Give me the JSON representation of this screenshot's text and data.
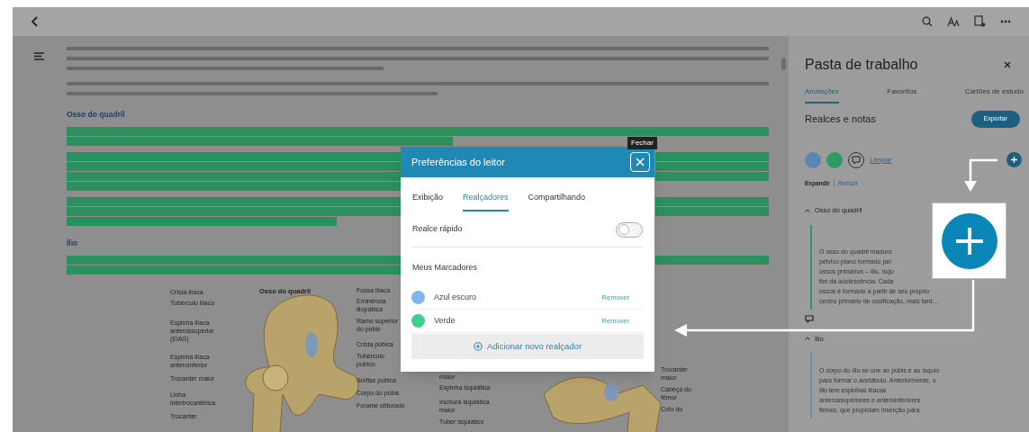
{
  "document": {
    "blocks": [
      {
        "kind": "paragraph",
        "highlighted": false
      },
      {
        "kind": "paragraph",
        "highlighted": false
      },
      {
        "kind": "heading",
        "text": "Osso do quadril"
      },
      {
        "kind": "paragraph",
        "highlighted": true
      },
      {
        "kind": "paragraph",
        "highlighted": true
      },
      {
        "kind": "paragraph",
        "highlighted": true
      },
      {
        "kind": "heading",
        "text": "Ílio"
      },
      {
        "kind": "paragraph",
        "highlighted": true
      }
    ]
  },
  "figure": {
    "title": "Osso do quadril",
    "labels_left": [
      "Crista ilíaca",
      "Tubérculo ilíaco",
      "Espinha ilíaca anterossuperior (EIAS)",
      "Espinha ilíaca anteroinferior",
      "Trocanter maior",
      "Linha intertrocantérica",
      "Trocanter"
    ],
    "labels_right": [
      "Fossa ilíaca",
      "Eminência iliopúbica",
      "Ramo superior do púbis",
      "Crista púbica",
      "Tubérculo púbico",
      "Sínfise púbica",
      "Corpo do púbis",
      "Forame obturado"
    ],
    "labels_second_left": [
      "maior",
      "Espinha isquiática",
      "Incisura isquiática maior",
      "Túber isquiático"
    ],
    "labels_second_right": [
      "Trocanter maior",
      "Cabeça do fêmur",
      "Colo do"
    ]
  },
  "dialog": {
    "title": "Preferências do leitor",
    "tooltip": "Fechar",
    "tabs": [
      {
        "label": "Exibição",
        "selected": false
      },
      {
        "label": "Realçadores",
        "selected": true
      },
      {
        "label": "Compartilhando",
        "selected": false
      }
    ],
    "quick_highlight": {
      "label": "Realce rápido",
      "on": false
    },
    "markers_heading": "Meus Marcadores",
    "markers": [
      {
        "name": "Azul escuro",
        "color": "#7fb6ea",
        "action": "Remover"
      },
      {
        "name": "Verde",
        "color": "#3ccf8e",
        "action": "Remover"
      }
    ],
    "add_button": "Adicionar novo realçador"
  },
  "panel": {
    "title": "Pasta de trabalho",
    "tabs": [
      {
        "label": "Anotações",
        "selected": true
      },
      {
        "label": "Favoritos",
        "selected": false
      },
      {
        "label": "Cartões de estudo",
        "selected": false
      }
    ],
    "section_title": "Realces e notas",
    "export_button": "Exportar",
    "filter_colors": [
      {
        "color": "#5a86b8"
      },
      {
        "color": "#2f9a62"
      }
    ],
    "clear_link": "Limpar",
    "expand": "Expandir",
    "collapse": "Reduzir",
    "groups": [
      {
        "title": "Osso do quadril",
        "expanded": true,
        "color": "#2f9a62",
        "note_lines": [
          "O osso do quadril maduro",
          "pélvico plano formado pel",
          "ossos primários – ílio, ísqu",
          "fim da adolescência. Cada",
          "ossos é formado a partir de seu próprio",
          "centro primário de ossificação, mais tard…"
        ]
      },
      {
        "title": "Ílio",
        "expanded": true,
        "color": "#6f8fb0",
        "note_lines": [
          "O corpo do ílio se une ao púbis e ao ísquio",
          "para formar o acetábulo. Anteriormente, o",
          "ílio tem espinhas ilíacas",
          "anterossuperiores e anteroinferiores",
          "firmes, que propiciam inserção para"
        ]
      }
    ]
  }
}
